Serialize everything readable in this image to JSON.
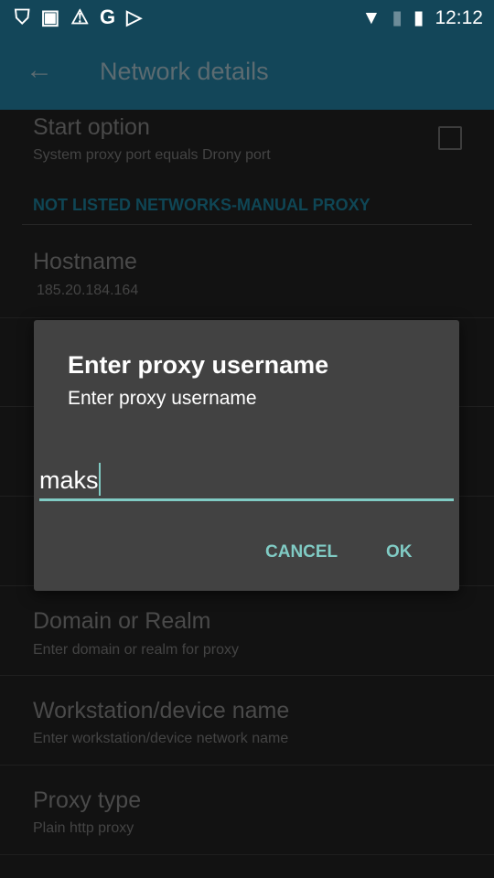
{
  "status_bar": {
    "icons": [
      "shield-play-icon",
      "image-icon",
      "warning-icon",
      "google-icon",
      "play-store-icon"
    ],
    "right_icons": [
      "wifi-icon",
      "no-sim-icon",
      "battery-charging-icon"
    ],
    "time": "12:12"
  },
  "app_bar": {
    "title": "Network details"
  },
  "settings": {
    "start_option": {
      "title": "Start option",
      "summary": "System proxy port equals Drony port",
      "checked": false
    },
    "category": "NOT LISTED NETWORKS-MANUAL PROXY",
    "hostname": {
      "title": "Hostname",
      "summary": "185.20.184.164"
    },
    "domain": {
      "title": "Domain or Realm",
      "summary": "Enter domain or realm for proxy"
    },
    "workstation": {
      "title": "Workstation/device name",
      "summary": "Enter workstation/device network name"
    },
    "proxy_type": {
      "title": "Proxy type",
      "summary": "Plain http proxy"
    }
  },
  "dialog": {
    "title": "Enter proxy username",
    "message": "Enter proxy username",
    "value": "maks",
    "cancel": "CANCEL",
    "ok": "OK",
    "accent": "#80cbc4"
  }
}
